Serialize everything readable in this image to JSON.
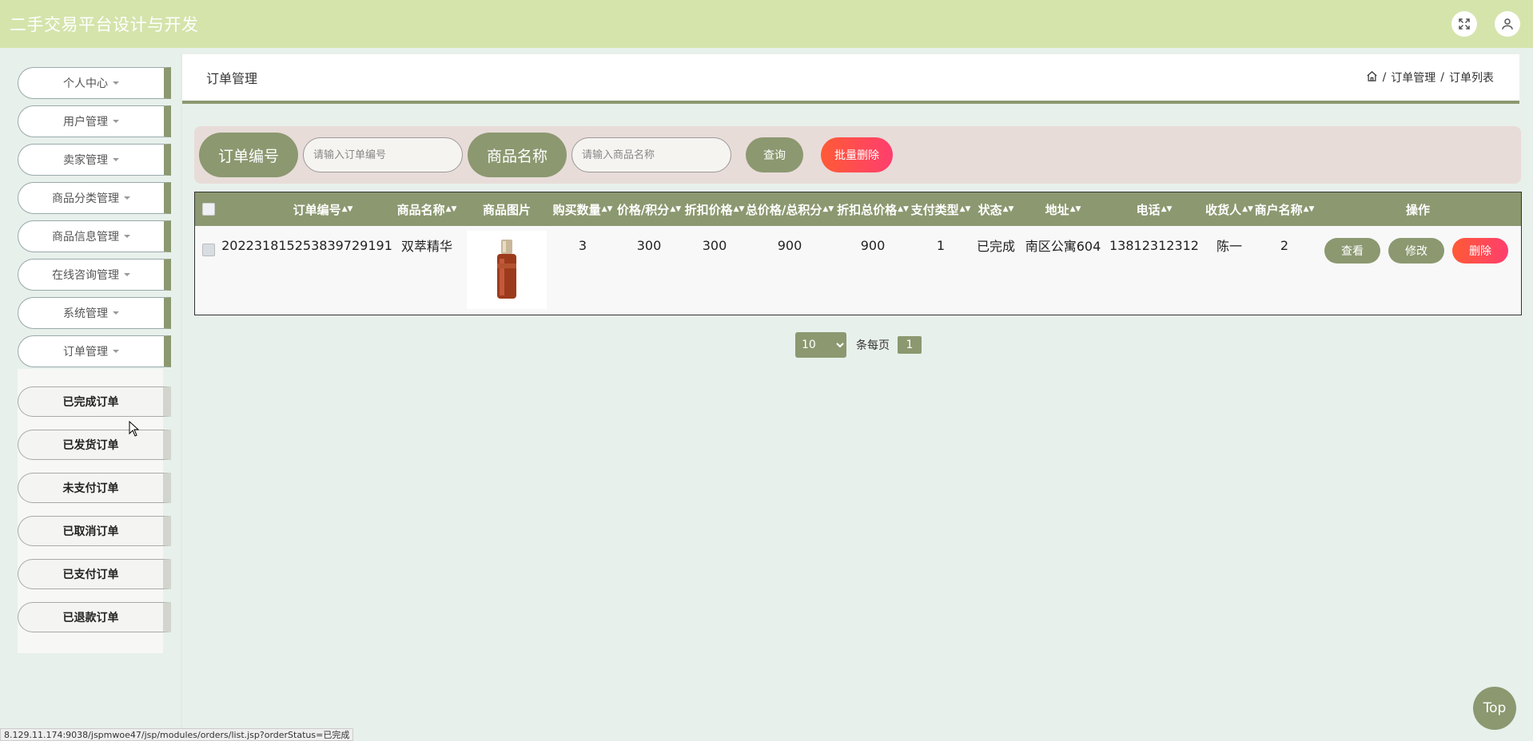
{
  "app": {
    "title": "二手交易平台设计与开发"
  },
  "sidebar": {
    "items": [
      {
        "label": "个人中心"
      },
      {
        "label": "用户管理"
      },
      {
        "label": "卖家管理"
      },
      {
        "label": "商品分类管理"
      },
      {
        "label": "商品信息管理"
      },
      {
        "label": "在线咨询管理"
      },
      {
        "label": "系统管理"
      },
      {
        "label": "订单管理"
      }
    ],
    "subitems": [
      {
        "label": "已完成订单"
      },
      {
        "label": "已发货订单"
      },
      {
        "label": "未支付订单"
      },
      {
        "label": "已取消订单"
      },
      {
        "label": "已支付订单"
      },
      {
        "label": "已退款订单"
      }
    ]
  },
  "header": {
    "page_title": "订单管理",
    "breadcrumb": [
      "订单管理",
      "订单列表"
    ],
    "separator": "/"
  },
  "search": {
    "order_label": "订单编号",
    "order_placeholder": "请输入订单编号",
    "product_label": "商品名称",
    "product_placeholder": "请输入商品名称",
    "query_label": "查询",
    "batch_delete_label": "批量删除"
  },
  "table": {
    "columns": [
      "订单编号",
      "商品名称",
      "商品图片",
      "购买数量",
      "价格/积分",
      "折扣价格",
      "总价格/总积分",
      "折扣总价格",
      "支付类型",
      "状态",
      "地址",
      "电话",
      "收货人",
      "商户名称",
      "操作"
    ],
    "rows": [
      {
        "order_no": "202231815253839729191",
        "product_name": "双萃精华",
        "quantity": "3",
        "price": "300",
        "discount_price": "300",
        "total_price": "900",
        "discount_total": "900",
        "pay_type": "1",
        "status": "已完成",
        "address": "南区公寓604",
        "phone": "13812312312",
        "receiver": "陈一",
        "merchant": "2"
      }
    ],
    "actions": {
      "view": "查看",
      "edit": "修改",
      "delete": "删除"
    }
  },
  "pager": {
    "page_size": "10",
    "page_size_options": [
      "10"
    ],
    "per_page_label": "条每页",
    "current_page": "1"
  },
  "top_button": "Top",
  "status_url": "8.129.11.174:9038/jspmwoe47/jsp/modules/orders/list.jsp?orderStatus=已完成",
  "colors": {
    "topbar": "#d4e4ab",
    "accent": "#8c9870",
    "danger": "#ff4a50",
    "search_bg": "#e8dcd9",
    "page_bg": "#e8f0eb"
  }
}
